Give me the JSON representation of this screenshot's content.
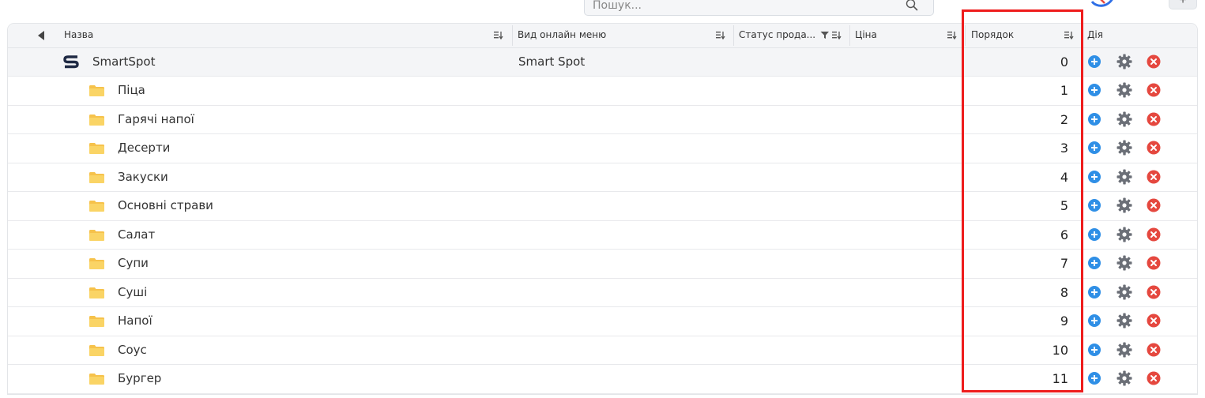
{
  "search": {
    "placeholder": "Пошук..."
  },
  "header": {
    "columns": [
      {
        "key": "name",
        "label": "Назва"
      },
      {
        "key": "menu_view",
        "label": "Вид онлайн меню"
      },
      {
        "key": "sale_status",
        "label": "Статус прода..."
      },
      {
        "key": "price",
        "label": "Ціна"
      },
      {
        "key": "order",
        "label": "Порядок"
      },
      {
        "key": "action",
        "label": "Дія"
      }
    ]
  },
  "root": {
    "name": "SmartSpot",
    "menu_view": "Smart Spot",
    "order": "0"
  },
  "rows": [
    {
      "name": "Піца",
      "order": "1"
    },
    {
      "name": "Гарячі напої",
      "order": "2"
    },
    {
      "name": "Десерти",
      "order": "3"
    },
    {
      "name": "Закуски",
      "order": "4"
    },
    {
      "name": "Основні страви",
      "order": "5"
    },
    {
      "name": "Салат",
      "order": "6"
    },
    {
      "name": "Супи",
      "order": "7"
    },
    {
      "name": "Суші",
      "order": "8"
    },
    {
      "name": "Напої",
      "order": "9"
    },
    {
      "name": "Соус",
      "order": "10"
    },
    {
      "name": "Бургер",
      "order": "11"
    }
  ],
  "toolbar": {
    "plus_label": "+"
  },
  "colors": {
    "highlight": "#ee1c1c",
    "add": "#2f8fe6",
    "delete": "#e5483f",
    "folder": "#f6c24b"
  },
  "icons": [
    "search-icon",
    "sort-icon",
    "filter-icon",
    "folder-icon",
    "add-icon",
    "gear-icon",
    "delete-icon"
  ]
}
